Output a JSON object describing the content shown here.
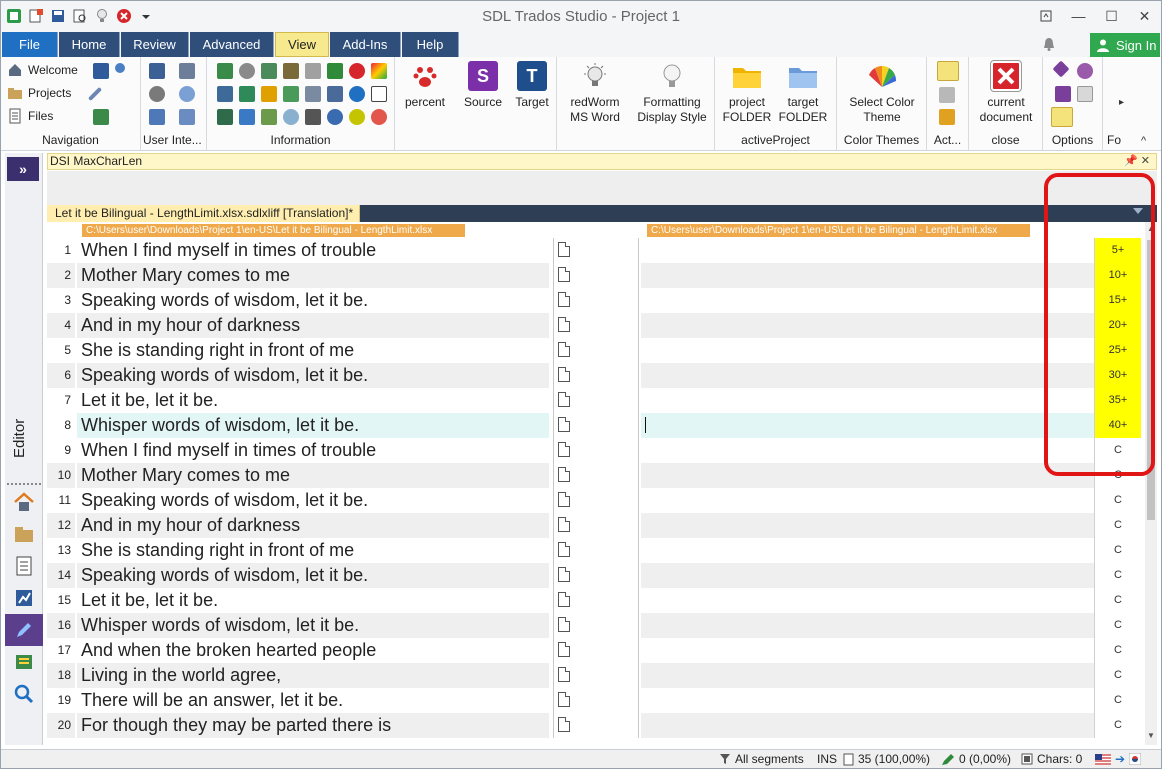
{
  "app": {
    "title": "SDL Trados Studio - Project 1"
  },
  "tabs": [
    {
      "label": "File"
    },
    {
      "label": "Home"
    },
    {
      "label": "Review"
    },
    {
      "label": "Advanced"
    },
    {
      "label": "View"
    },
    {
      "label": "Add-Ins"
    },
    {
      "label": "Help"
    }
  ],
  "account": {
    "signin_label": "Sign In"
  },
  "ribbon": {
    "navigation": {
      "group_label": "Navigation",
      "items": [
        {
          "label": "Welcome"
        },
        {
          "label": "Projects"
        },
        {
          "label": "Files"
        }
      ]
    },
    "user_inte": {
      "label_user": "User",
      "label_inte": "Inte..."
    },
    "information": {
      "group_label": "Information"
    },
    "percent": {
      "label": "percent"
    },
    "source": {
      "label": "Source",
      "icon_letter": "S",
      "color": "#7b2fa8"
    },
    "target": {
      "label": "Target",
      "icon_letter": "T",
      "color": "#1f4e8c"
    },
    "redworm": {
      "line1": "redWorm",
      "line2": "MS Word"
    },
    "formatting": {
      "line1": "Formatting",
      "line2": "Display Style"
    },
    "active_project": {
      "group_label": "activeProject",
      "project_folder": {
        "line1": "project",
        "line2": "FOLDER"
      },
      "target_folder": {
        "line1": "target",
        "line2": "FOLDER"
      }
    },
    "color_themes": {
      "group_label": "Color Themes",
      "line1": "Select Color",
      "line2": "Theme"
    },
    "act": {
      "group_label": "Act..."
    },
    "close": {
      "group_label": "close",
      "line1": "current",
      "line2": "document"
    },
    "options": {
      "group_label": "Options"
    },
    "fo": {
      "group_label": "Fo"
    }
  },
  "side": {
    "editor_label": "Editor"
  },
  "pane": {
    "title": "DSI MaxCharLen"
  },
  "document": {
    "tab_label": "Let it be Bilingual - LengthLimit.xlsx.sdlxliff [Translation]",
    "modified_marker": "*",
    "source_path": "C:\\Users\\user\\Downloads\\Project 1\\en-US\\Let it be Bilingual - LengthLimit.xlsx",
    "target_path": "C:\\Users\\user\\Downloads\\Project 1\\en-US\\Let it be Bilingual - LengthLimit.xlsx"
  },
  "segments": [
    {
      "num": "1",
      "source": "When I find myself in times of trouble",
      "length": "5+"
    },
    {
      "num": "2",
      "source": "Mother Mary comes to me",
      "length": "10+"
    },
    {
      "num": "3",
      "source": "Speaking words of wisdom, let it be.",
      "length": "15+"
    },
    {
      "num": "4",
      "source": "And in my hour of darkness",
      "length": "20+"
    },
    {
      "num": "5",
      "source": "She is standing right in front of me",
      "length": "25+"
    },
    {
      "num": "6",
      "source": "Speaking words of wisdom, let it be.",
      "length": "30+"
    },
    {
      "num": "7",
      "source": "Let it be, let it be.",
      "length": "35+"
    },
    {
      "num": "8",
      "source": "Whisper words of wisdom, let it be.",
      "length": "40+"
    },
    {
      "num": "9",
      "source": "When I find myself in times of trouble",
      "length": "C"
    },
    {
      "num": "10",
      "source": "Mother Mary comes to me",
      "length": "C"
    },
    {
      "num": "11",
      "source": "Speaking words of wisdom, let it be.",
      "length": "C"
    },
    {
      "num": "12",
      "source": "And in my hour of darkness",
      "length": "C"
    },
    {
      "num": "13",
      "source": "She is standing right in front of me",
      "length": "C"
    },
    {
      "num": "14",
      "source": "Speaking words of wisdom, let it be.",
      "length": "C"
    },
    {
      "num": "15",
      "source": "Let it be, let it be.",
      "length": "C"
    },
    {
      "num": "16",
      "source": "Whisper words of wisdom, let it be.",
      "length": "C"
    },
    {
      "num": "17",
      "source": "And when the broken hearted people",
      "length": "C"
    },
    {
      "num": "18",
      "source": "Living in the world agree,",
      "length": "C"
    },
    {
      "num": "19",
      "source": "There will be an answer, let it be.",
      "length": "C"
    },
    {
      "num": "20",
      "source": "For though they may be parted there is",
      "length": "C"
    }
  ],
  "selected_segment": "8",
  "status": {
    "filter": "All segments",
    "mode": "INS",
    "segments": "35 (100,00%)",
    "confirmed": "0 (0,00%)",
    "chars": "Chars: 0"
  },
  "colors": {
    "highlight": "#ffff00",
    "callout": "#e01616",
    "accent": "#2f4f7a",
    "file_tab": "#1f6fc2",
    "active_tab": "#f7e98e"
  }
}
